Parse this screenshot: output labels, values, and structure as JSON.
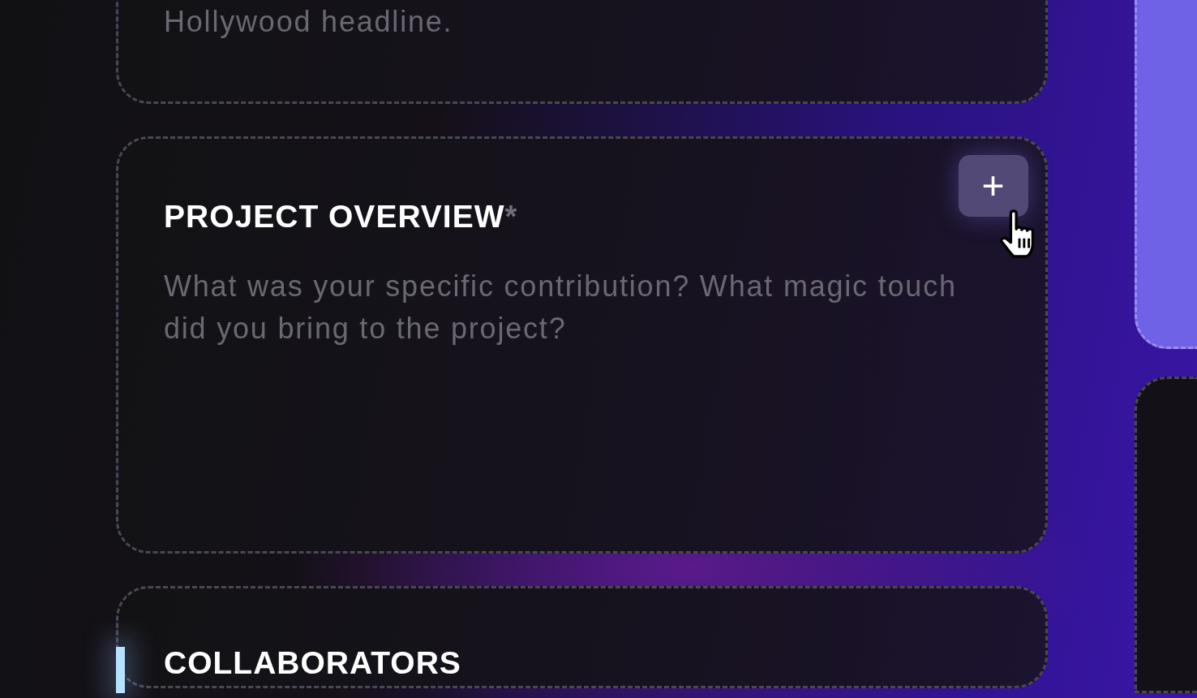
{
  "sections": [
    {
      "kind": "text",
      "placeholder": "Hollywood headline.",
      "active": false
    },
    {
      "kind": "text",
      "title": "PROJECT OVERVIEW",
      "required": true,
      "required_mark": "*",
      "add_button": "+",
      "placeholder": "What was your specific contribution? What magic touch did you bring to the project?",
      "active": false
    },
    {
      "kind": "list",
      "title": "COLLABORATORS",
      "active": true
    }
  ]
}
